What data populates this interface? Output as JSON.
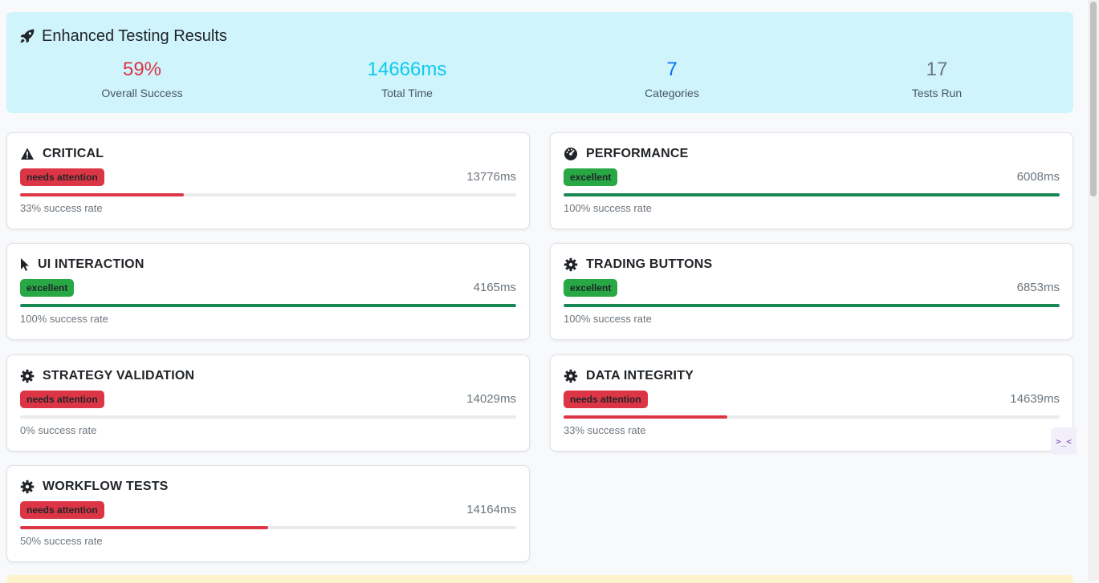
{
  "summary": {
    "title": "Enhanced Testing Results",
    "title_icon": "rocket-icon",
    "stats": [
      {
        "value": "59%",
        "label": "Overall Success",
        "color": "#dc3545"
      },
      {
        "value": "14666ms",
        "label": "Total Time",
        "color": "#0dcaf0"
      },
      {
        "value": "7",
        "label": "Categories",
        "color": "#0d6efd"
      },
      {
        "value": "17",
        "label": "Tests Run",
        "color": "#6c757d"
      }
    ]
  },
  "categories": [
    {
      "name": "CRITICAL",
      "icon": "warning-icon",
      "status": "needs attention",
      "status_color": "#dc3545",
      "time": "13776ms",
      "rate": 33,
      "rate_text": "33% success rate"
    },
    {
      "name": "PERFORMANCE",
      "icon": "speedometer-icon",
      "status": "excellent",
      "status_color": "#28a745",
      "time": "6008ms",
      "rate": 100,
      "rate_text": "100% success rate"
    },
    {
      "name": "UI INTERACTION",
      "icon": "pointer-icon",
      "status": "excellent",
      "status_color": "#28a745",
      "time": "4165ms",
      "rate": 100,
      "rate_text": "100% success rate"
    },
    {
      "name": "TRADING BUTTONS",
      "icon": "gear-icon",
      "status": "excellent",
      "status_color": "#28a745",
      "time": "6853ms",
      "rate": 100,
      "rate_text": "100% success rate"
    },
    {
      "name": "STRATEGY VALIDATION",
      "icon": "gear-icon",
      "status": "needs attention",
      "status_color": "#dc3545",
      "time": "14029ms",
      "rate": 0,
      "rate_text": "0% success rate"
    },
    {
      "name": "DATA INTEGRITY",
      "icon": "gear-icon",
      "status": "needs attention",
      "status_color": "#dc3545",
      "time": "14639ms",
      "rate": 33,
      "rate_text": "33% success rate"
    },
    {
      "name": "WORKFLOW TESTS",
      "icon": "gear-icon",
      "status": "needs attention",
      "status_color": "#dc3545",
      "time": "14164ms",
      "rate": 50,
      "rate_text": "50% success rate"
    }
  ],
  "side_widget": {
    "icon": "code-collapse-icon",
    "glyph": ">_<"
  }
}
